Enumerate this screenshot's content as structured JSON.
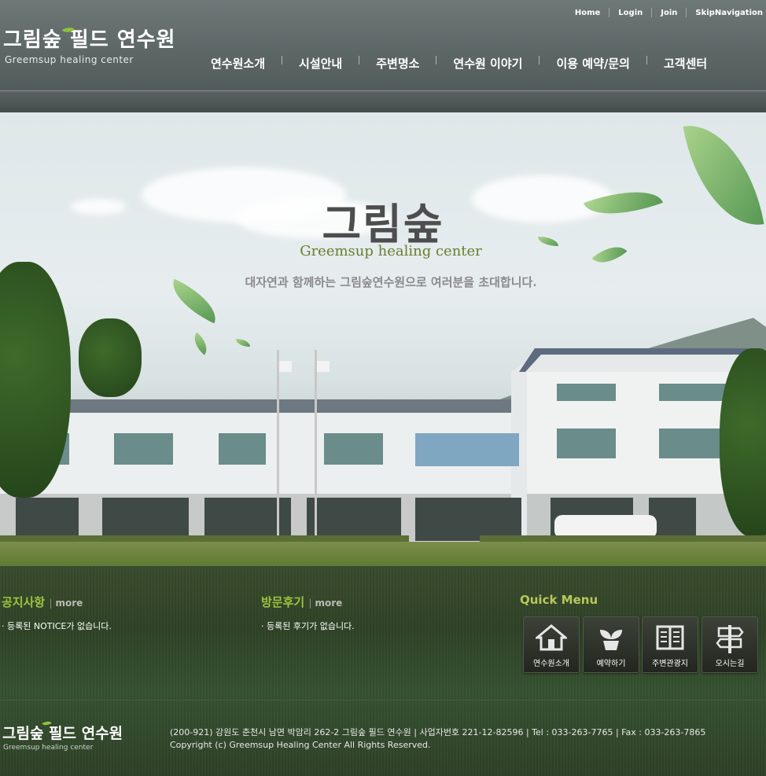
{
  "header": {
    "logo_title": "그림숲 필드 연수원",
    "logo_subtitle": "Greemsup healing center",
    "top_links": [
      "Home",
      "Login",
      "Join",
      "SkipNavigation"
    ],
    "nav": [
      "연수원소개",
      "시설안내",
      "주변명소",
      "연수원 이야기",
      "이용 예약/문의",
      "고객센터"
    ]
  },
  "hero": {
    "title": "그림숲",
    "subtitle": "Greemsup healing center",
    "description": "대자연과 함께하는 그림숲연수원으로 여러분을 초대합니다."
  },
  "notice": {
    "title": "공지사항",
    "more": "more",
    "item": "· 등록된 NOTICE가 없습니다."
  },
  "review": {
    "title": "방문후기",
    "more": "more",
    "item": "· 등록된 후기가 없습니다."
  },
  "quick_menu": {
    "title": "Quick Menu",
    "items": [
      {
        "label": "연수원소개",
        "icon": "house-icon"
      },
      {
        "label": "예약하기",
        "icon": "sprout-pot-icon"
      },
      {
        "label": "주변관광지",
        "icon": "book-icon"
      },
      {
        "label": "오시는길",
        "icon": "signpost-icon"
      }
    ]
  },
  "footer": {
    "logo_title": "그림숲 필드 연수원",
    "logo_subtitle": "Greemsup healing center",
    "address": "(200-921) 강원도 춘천시 남면 박암리 262-2 그림숲 필드 연수원 | 사업자번호 221-12-82596 | Tel : 033-263-7765 | Fax : 033-263-7865",
    "copyright": "Copyright (c) Greemsup Healing Center All Rights Reserved."
  },
  "colors": {
    "header_bg": "#5c6665",
    "accent_green": "#9dc43e",
    "quick_menu_title": "#b7c85a",
    "lower_bg": "#2f4226"
  }
}
